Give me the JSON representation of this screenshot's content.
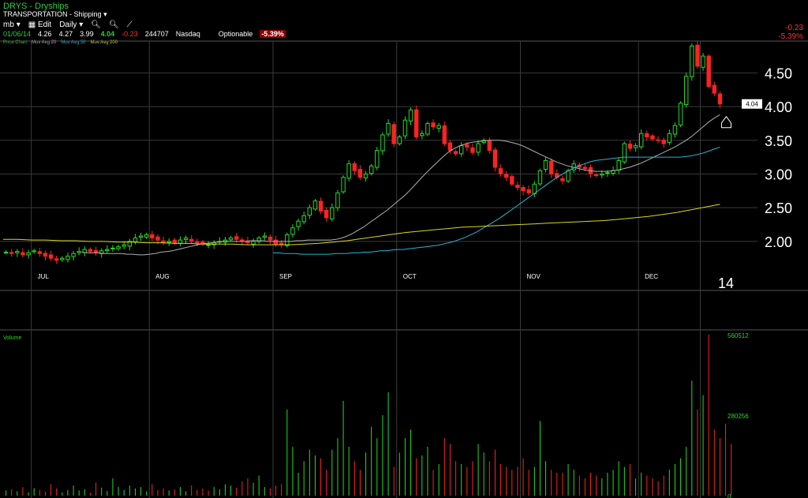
{
  "header": {
    "ticker_line": "DRYS - Dryships",
    "sector_line": "TRANSPORTATION - Shipping",
    "toolbar": {
      "menu": "mb",
      "edit": "Edit",
      "period": "Daily"
    },
    "quote": {
      "date": "01/06/14",
      "open": "4.26",
      "high": "4.27",
      "low": "3.99",
      "last": "4.04",
      "change": "-0.23",
      "volume": "244707",
      "exchange": "Nasdaq",
      "optionable": "Optionable",
      "pct": "-5.39%"
    },
    "top_right_change": "-0.23",
    "top_right_pct": "-5.39%"
  },
  "legend": {
    "price_chart": "Price Chart",
    "ma20": "Mov Avg 20",
    "ma50": "Mov Avg 50",
    "ma200": "Mov Avg 200"
  },
  "colors": {
    "up": "#22dd22",
    "down": "#ff2222",
    "ma20": "#b0b0b0",
    "ma50": "#22b8d8",
    "ma200": "#d8d820",
    "grid": "#3a3a3a",
    "axis_text": "#ffffff",
    "volume_axis": "#22dd22"
  },
  "price_axis": {
    "ticks": [
      "4.50",
      "4.00",
      "3.50",
      "3.00",
      "2.50",
      "2.00"
    ],
    "last_tag": "4.04"
  },
  "month_labels": [
    "JUL",
    "AUG",
    "SEP",
    "OCT",
    "NOV",
    "DEC"
  ],
  "year_label": "14",
  "volume_panel": {
    "label": "Volume",
    "ticks": [
      "560512",
      "280256",
      "0"
    ]
  },
  "chart_data": [
    {
      "type": "candlestick",
      "title": "DRYS - Dryships",
      "x_labels": [
        "JUL",
        "AUG",
        "SEP",
        "OCT",
        "NOV",
        "DEC",
        "14"
      ],
      "ylim": [
        1.6,
        4.95
      ],
      "ticks": [
        2.0,
        2.5,
        3.0,
        3.5,
        4.0,
        4.5
      ],
      "grid": true,
      "closes": [
        1.84,
        1.82,
        1.85,
        1.8,
        1.83,
        1.86,
        1.82,
        1.78,
        1.75,
        1.72,
        1.75,
        1.78,
        1.82,
        1.85,
        1.88,
        1.85,
        1.83,
        1.86,
        1.88,
        1.9,
        1.92,
        1.95,
        2.0,
        2.05,
        2.08,
        2.1,
        2.05,
        2.02,
        1.98,
        2.0,
        1.98,
        2.02,
        2.05,
        2.0,
        1.98,
        1.96,
        1.95,
        1.98,
        2.0,
        2.02,
        2.05,
        2.03,
        2.0,
        1.98,
        2.0,
        2.05,
        2.08,
        2.02,
        1.96,
        1.95,
        2.1,
        2.2,
        2.3,
        2.38,
        2.5,
        2.6,
        2.45,
        2.35,
        2.5,
        2.72,
        2.95,
        3.15,
        3.05,
        2.95,
        3.0,
        3.12,
        3.35,
        3.58,
        3.75,
        3.45,
        3.55,
        3.8,
        3.95,
        3.55,
        3.6,
        3.75,
        3.7,
        3.72,
        3.45,
        3.35,
        3.3,
        3.42,
        3.4,
        3.32,
        3.45,
        3.5,
        3.35,
        3.1,
        3.0,
        2.95,
        2.85,
        2.8,
        2.75,
        2.72,
        2.85,
        3.05,
        3.2,
        3.0,
        2.95,
        2.9,
        3.05,
        3.15,
        3.1,
        3.08,
        3.0,
        2.98,
        3.0,
        3.02,
        3.05,
        3.2,
        3.45,
        3.38,
        3.42,
        3.6,
        3.55,
        3.52,
        3.5,
        3.45,
        3.6,
        3.72,
        4.05,
        4.45,
        4.9,
        4.6,
        4.75,
        4.3,
        4.2,
        4.04
      ],
      "series": [
        {
          "name": "Mov Avg 20",
          "values": [
            1.84,
            1.83,
            1.83,
            1.83,
            1.82,
            1.82,
            1.82,
            1.82,
            1.81,
            1.81,
            1.8,
            1.8,
            1.81,
            1.82,
            1.84,
            1.85,
            1.86,
            1.88,
            1.9,
            1.92,
            1.94,
            1.96,
            1.97,
            1.98,
            1.99,
            2.0,
            2.0,
            2.0,
            2.0,
            2.0,
            2.01,
            2.01,
            2.01,
            2.0,
            2.0,
            2.0,
            2.0,
            2.0,
            2.01,
            2.01,
            2.02,
            2.02,
            2.02,
            2.02,
            2.02,
            2.03,
            2.05,
            2.08,
            2.12,
            2.17,
            2.22,
            2.28,
            2.34,
            2.4,
            2.46,
            2.53,
            2.6,
            2.67,
            2.75,
            2.84,
            2.93,
            3.02,
            3.1,
            3.18,
            3.26,
            3.33,
            3.38,
            3.42,
            3.45,
            3.47,
            3.48,
            3.49,
            3.5,
            3.5,
            3.5,
            3.49,
            3.47,
            3.45,
            3.42,
            3.38,
            3.34,
            3.3,
            3.26,
            3.22,
            3.18,
            3.15,
            3.12,
            3.1,
            3.08,
            3.06,
            3.05,
            3.04,
            3.04,
            3.04,
            3.05,
            3.06,
            3.08,
            3.1,
            3.13,
            3.16,
            3.2,
            3.24,
            3.28,
            3.32,
            3.36,
            3.4,
            3.45,
            3.5,
            3.56,
            3.63,
            3.7,
            3.77,
            3.83,
            3.88
          ]
        },
        {
          "name": "Mov Avg 50",
          "values": [
            1.83,
            1.83,
            1.82,
            1.82,
            1.82,
            1.81,
            1.81,
            1.81,
            1.81,
            1.81,
            1.81,
            1.82,
            1.82,
            1.82,
            1.83,
            1.83,
            1.84,
            1.84,
            1.85,
            1.86,
            1.86,
            1.87,
            1.88,
            1.88,
            1.89,
            1.9,
            1.91,
            1.92,
            1.93,
            1.94,
            1.96,
            1.98,
            2.0,
            2.03,
            2.06,
            2.1,
            2.14,
            2.19,
            2.24,
            2.29,
            2.34,
            2.4,
            2.46,
            2.52,
            2.58,
            2.64,
            2.7,
            2.76,
            2.82,
            2.88,
            2.94,
            2.99,
            3.04,
            3.08,
            3.12,
            3.15,
            3.18,
            3.2,
            3.21,
            3.22,
            3.23,
            3.24,
            3.25,
            3.25,
            3.25,
            3.25,
            3.25,
            3.25,
            3.25,
            3.25,
            3.25,
            3.25,
            3.25,
            3.26,
            3.27,
            3.29,
            3.31,
            3.34,
            3.37,
            3.4
          ]
        },
        {
          "name": "Mov Avg 200",
          "values": [
            2.03,
            2.03,
            2.02,
            2.02,
            2.01,
            2.01,
            2.0,
            2.0,
            1.99,
            1.99,
            1.98,
            1.98,
            1.97,
            1.97,
            1.96,
            1.96,
            1.96,
            1.95,
            1.95,
            1.95,
            1.95,
            1.96,
            1.97,
            1.99,
            2.01,
            2.04,
            2.07,
            2.1,
            2.13,
            2.15,
            2.17,
            2.19,
            2.21,
            2.22,
            2.23,
            2.24,
            2.25,
            2.26,
            2.27,
            2.28,
            2.29,
            2.3,
            2.31,
            2.33,
            2.35,
            2.37,
            2.4,
            2.43,
            2.47,
            2.51,
            2.55
          ]
        }
      ]
    },
    {
      "type": "bar",
      "title": "Volume",
      "ylim": [
        0,
        560512
      ],
      "ticks": [
        0,
        280256,
        560512
      ],
      "values": [
        18000,
        22000,
        15000,
        30000,
        12000,
        26000,
        20000,
        14000,
        40000,
        25000,
        12000,
        20000,
        35000,
        18000,
        22000,
        10000,
        45000,
        28000,
        16000,
        60000,
        30000,
        20000,
        35000,
        25000,
        30000,
        15000,
        40000,
        20000,
        25000,
        18000,
        22000,
        30000,
        15000,
        35000,
        20000,
        25000,
        18000,
        30000,
        22000,
        40000,
        35000,
        28000,
        50000,
        60000,
        45000,
        70000,
        30000,
        25000,
        35000,
        40000,
        300000,
        170000,
        80000,
        120000,
        160000,
        140000,
        130000,
        90000,
        160000,
        200000,
        330000,
        170000,
        120000,
        90000,
        150000,
        240000,
        200000,
        280000,
        360000,
        100000,
        150000,
        200000,
        230000,
        130000,
        140000,
        170000,
        90000,
        110000,
        200000,
        180000,
        120000,
        110000,
        100000,
        120000,
        180000,
        150000,
        120000,
        160000,
        110000,
        100000,
        90000,
        100000,
        130000,
        90000,
        100000,
        260000,
        120000,
        90000,
        80000,
        80000,
        110000,
        90000,
        70000,
        60000,
        80000,
        70000,
        60000,
        80000,
        90000,
        120000,
        100000,
        110000,
        60000,
        80000,
        70000,
        60000,
        50000,
        70000,
        90000,
        110000,
        130000,
        170000,
        400000,
        300000,
        350000,
        560512,
        230000,
        200000,
        250000,
        180000
      ],
      "colors_by_direction": true
    }
  ]
}
